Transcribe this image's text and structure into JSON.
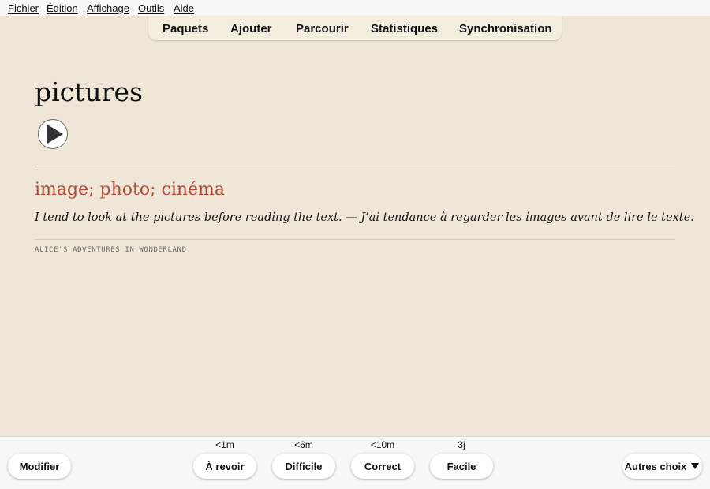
{
  "menu": [
    "Fichier",
    "Édition",
    "Affichage",
    "Outils",
    "Aide"
  ],
  "tabs": [
    "Paquets",
    "Ajouter",
    "Parcourir",
    "Statistiques",
    "Synchronisation"
  ],
  "card": {
    "word": "pictures",
    "meaning": "image; photo; cinéma",
    "example": "I tend to look at the pictures before reading the text. — J’ai tendance à regarder les images avant de lire le texte.",
    "source": "ALICE'S ADVENTURES IN WONDERLAND",
    "play_icon": "play-icon",
    "colors": {
      "background": "#efe6d7",
      "meaning": "#ae4b37"
    }
  },
  "bottom": {
    "edit_label": "Modifier",
    "answers": [
      {
        "time": "<1m",
        "label": "À revoir"
      },
      {
        "time": "<6m",
        "label": "Difficile"
      },
      {
        "time": "<10m",
        "label": "Correct"
      },
      {
        "time": "3j",
        "label": "Facile"
      }
    ],
    "more_label": "Autres choix",
    "more_icon": "triangle-down-icon"
  }
}
